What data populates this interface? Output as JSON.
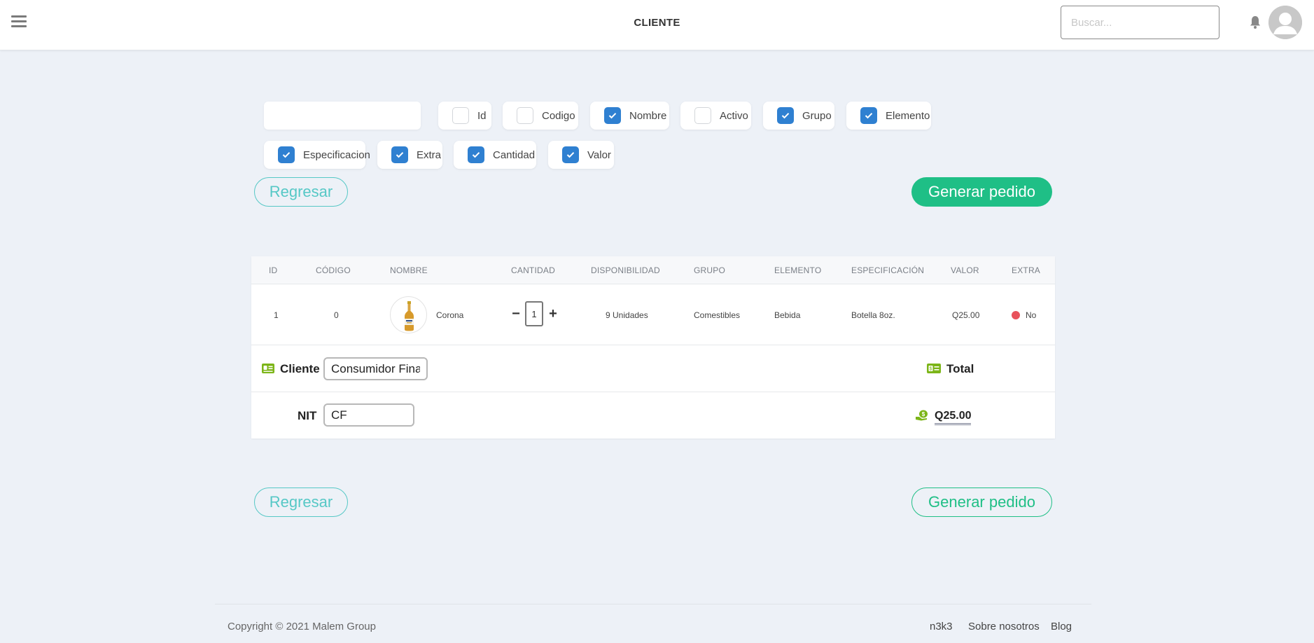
{
  "header": {
    "title": "CLIENTE",
    "search_placeholder": "Buscar..."
  },
  "filters": {
    "text_value": "",
    "columns": [
      {
        "label": "Id",
        "checked": false
      },
      {
        "label": "Codigo",
        "checked": false
      },
      {
        "label": "Nombre",
        "checked": true
      },
      {
        "label": "Activo",
        "checked": false
      },
      {
        "label": "Grupo",
        "checked": true
      },
      {
        "label": "Elemento",
        "checked": true
      },
      {
        "label": "Especificacion",
        "checked": true
      },
      {
        "label": "Extra",
        "checked": true
      },
      {
        "label": "Cantidad",
        "checked": true
      },
      {
        "label": "Valor",
        "checked": true
      }
    ]
  },
  "actions": {
    "back_label": "Regresar",
    "generate_label": "Generar pedido"
  },
  "table": {
    "headers": [
      "ID",
      "CÓDIGO",
      "NOMBRE",
      "CANTIDAD",
      "DISPONIBILIDAD",
      "GRUPO",
      "ELEMENTO",
      "ESPECIFICACIÓN",
      "VALOR",
      "EXTRA"
    ],
    "rows": [
      {
        "id": "1",
        "codigo": "0",
        "nombre": "Corona",
        "cantidad": "1",
        "disponibilidad": "9 Unidades",
        "grupo": "Comestibles",
        "elemento": "Bebida",
        "especificacion": "Botella 8oz.",
        "valor": "Q25.00",
        "extra": "No"
      }
    ]
  },
  "summary": {
    "cliente_label": "Cliente",
    "cliente_value": "Consumidor Final",
    "nit_label": "NIT",
    "nit_value": "CF",
    "total_label": "Total",
    "total_value": "Q25.00"
  },
  "footer": {
    "copyright": "Copyright © 2021 Malem Group",
    "links": [
      "n3k3",
      "Sobre nosotros",
      "Blog"
    ]
  },
  "colors": {
    "accent_blue": "#2f80d1",
    "green": "#1fbf86",
    "teal_outline": "#56c8c6",
    "status_red": "#e8525b",
    "icon_green": "#7cb518"
  }
}
